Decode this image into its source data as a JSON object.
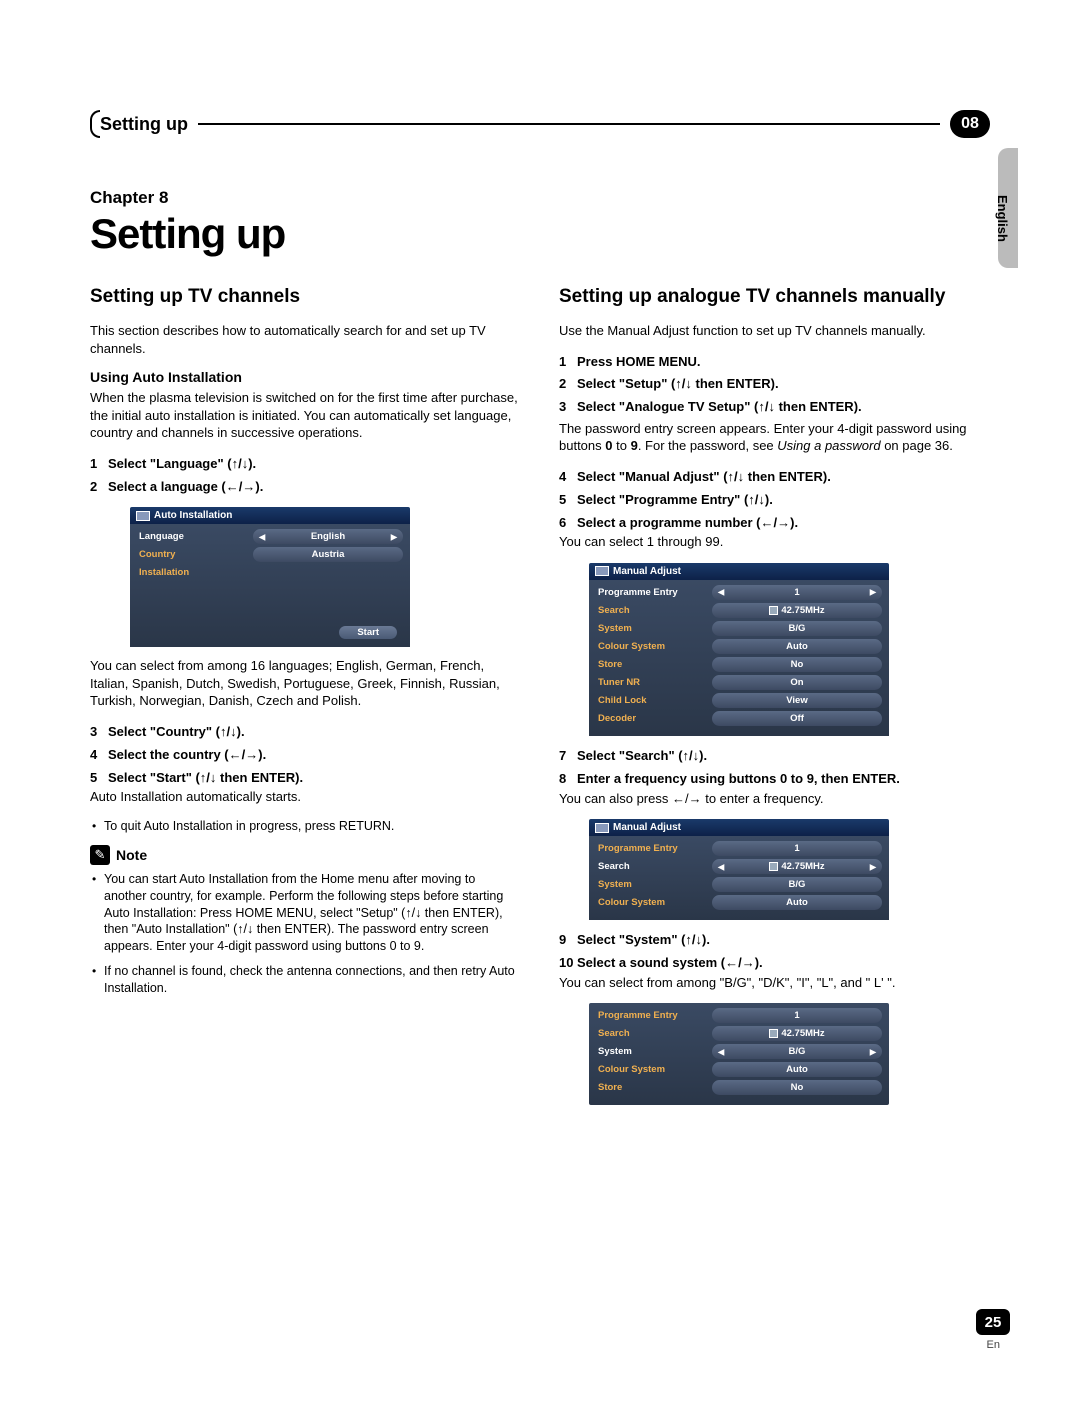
{
  "header": {
    "title": "Setting up",
    "badge": "08",
    "side_lang": "English"
  },
  "chapter": {
    "label": "Chapter 8",
    "title": "Setting up"
  },
  "left": {
    "h2": "Setting up TV channels",
    "intro": "This section describes how to automatically search for and set up TV channels.",
    "sub": "Using Auto Installation",
    "sub_body": "When the plasma television is switched on for the first time after purchase, the initial auto installation is initiated. You can automatically set language, country and channels in successive operations.",
    "steps_a": [
      {
        "n": "1",
        "t": "Select \"Language\" (↑/↓)."
      },
      {
        "n": "2",
        "t": "Select a language (←/→)."
      }
    ],
    "osd1": {
      "title": "Auto Installation",
      "rows": [
        {
          "label": "Language",
          "value": "English",
          "arrows": true
        },
        {
          "label": "Country",
          "value": "Austria"
        },
        {
          "label": "Installation",
          "value": ""
        }
      ],
      "start": "Start"
    },
    "after_osd1": "You can select from among 16 languages; English, German, French, Italian, Spanish, Dutch, Swedish, Portuguese, Greek, Finnish, Russian, Turkish, Norwegian, Danish, Czech and Polish.",
    "steps_b": [
      {
        "n": "3",
        "t": "Select \"Country\" (↑/↓)."
      },
      {
        "n": "4",
        "t": "Select the country (←/→)."
      },
      {
        "n": "5",
        "t": "Select \"Start\" (↑/↓ then ENTER)."
      }
    ],
    "after_steps_b": "Auto Installation automatically starts.",
    "bullet_return": "To quit Auto Installation in progress, press RETURN.",
    "note_label": "Note",
    "notes": [
      "You can start Auto Installation from the Home menu after moving to another country, for example. Perform the following steps before starting Auto Installation: Press HOME MENU, select \"Setup\" (↑/↓ then ENTER), then \"Auto Installation\" (↑/↓ then ENTER). The password entry screen appears. Enter your 4-digit password using buttons 0 to 9.",
      "If no channel is found, check the antenna connections, and then retry Auto Installation."
    ]
  },
  "right": {
    "h2": "Setting up analogue TV channels manually",
    "intro": "Use the Manual Adjust function to set up TV channels manually.",
    "steps_a": [
      {
        "n": "1",
        "t": "Press HOME MENU."
      },
      {
        "n": "2",
        "t": "Select \"Setup\" (↑/↓ then ENTER)."
      },
      {
        "n": "3",
        "t": "Select \"Analogue TV Setup\" (↑/↓ then ENTER)."
      }
    ],
    "pw_text_a": "The password entry screen appears. Enter your 4-digit password using buttons ",
    "pw_text_b": ". For the password, see ",
    "pw_text_c": " on page 36.",
    "pw_bold0": "0",
    "pw_to": " to ",
    "pw_bold9": "9",
    "pw_italic": "Using a password",
    "steps_b": [
      {
        "n": "4",
        "t": "Select \"Manual Adjust\" (↑/↓ then ENTER)."
      },
      {
        "n": "5",
        "t": "Select \"Programme Entry\" (↑/↓)."
      },
      {
        "n": "6",
        "t": "Select a programme number (←/→)."
      }
    ],
    "after_6": "You can select 1 through 99.",
    "osd1": {
      "title": "Manual Adjust",
      "rows": [
        {
          "label": "Programme Entry",
          "value": "1",
          "arrows": true
        },
        {
          "label": "Search",
          "value": "42.75MHz",
          "icon": true
        },
        {
          "label": "System",
          "value": "B/G"
        },
        {
          "label": "Colour System",
          "value": "Auto"
        },
        {
          "label": "Store",
          "value": "No"
        },
        {
          "label": "Tuner NR",
          "value": "On"
        },
        {
          "label": "Child Lock",
          "value": "View"
        },
        {
          "label": "Decoder",
          "value": "Off"
        }
      ]
    },
    "steps_c": [
      {
        "n": "7",
        "t": "Select \"Search\" (↑/↓)."
      },
      {
        "n": "8",
        "t": "Enter a frequency using buttons 0 to 9, then ENTER."
      }
    ],
    "after_8": "You can also press ←/→ to enter a frequency.",
    "osd2": {
      "title": "Manual Adjust",
      "rows": [
        {
          "label": "Programme Entry",
          "value": "1"
        },
        {
          "label": "Search",
          "value": "42.75MHz",
          "arrows": true,
          "icon": true
        },
        {
          "label": "System",
          "value": "B/G"
        },
        {
          "label": "Colour System",
          "value": "Auto"
        }
      ]
    },
    "steps_d": [
      {
        "n": "9",
        "t": "Select \"System\" (↑/↓)."
      },
      {
        "n": "10",
        "t": "Select a sound system (←/→)."
      }
    ],
    "after_10": "You can select from among \"B/G\", \"D/K\", \"I\", \"L\", and \" L' \".",
    "osd3": {
      "rows": [
        {
          "label": "Programme Entry",
          "value": "1"
        },
        {
          "label": "Search",
          "value": "42.75MHz",
          "icon": true
        },
        {
          "label": "System",
          "value": "B/G",
          "arrows": true
        },
        {
          "label": "Colour System",
          "value": "Auto"
        },
        {
          "label": "Store",
          "value": "No"
        }
      ]
    }
  },
  "footer": {
    "page": "25",
    "lang": "En"
  }
}
